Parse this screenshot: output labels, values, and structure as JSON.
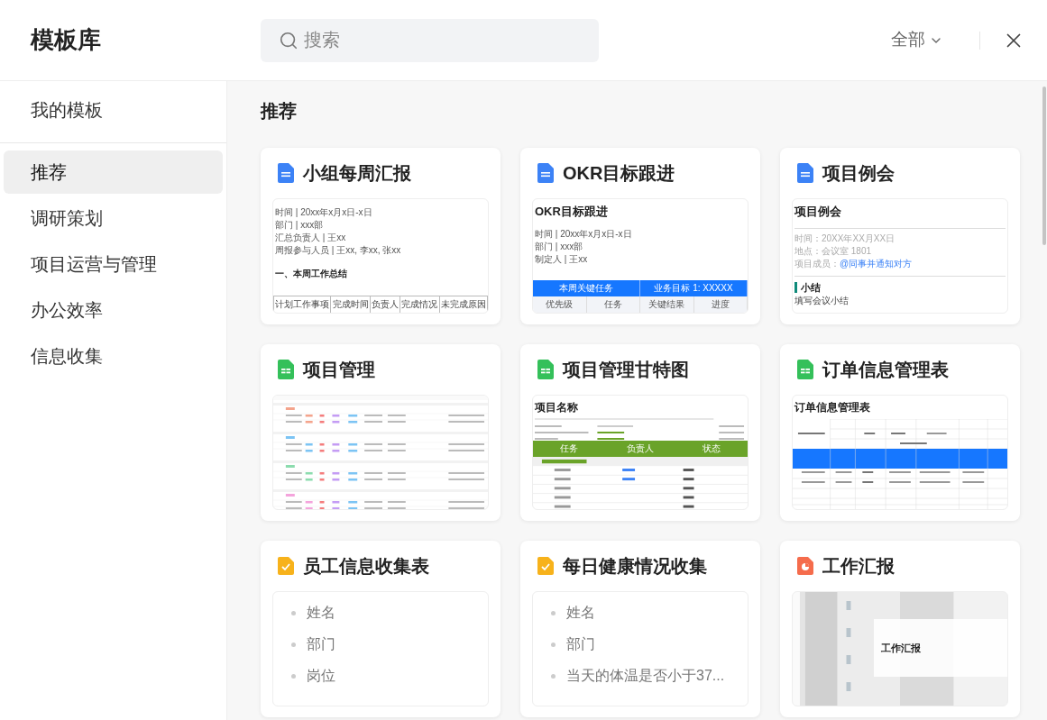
{
  "header": {
    "title": "模板库",
    "search": {
      "placeholder": "搜索"
    },
    "filter": "全部"
  },
  "sidebar": {
    "my_templates": {
      "label": "我的模板",
      "selected": false
    },
    "categories": [
      {
        "label": "推荐",
        "selected": true
      },
      {
        "label": "调研策划",
        "selected": false
      },
      {
        "label": "项目运营与管理",
        "selected": false
      },
      {
        "label": "办公效率",
        "selected": false
      },
      {
        "label": "信息收集",
        "selected": false
      }
    ]
  },
  "section": {
    "title": "推荐"
  },
  "templates": [
    {
      "title": "小组每周汇报",
      "kind": "doc",
      "preview": {
        "kind": "doc",
        "lines": [
          "时间 | 20xx年x月x日-x日",
          "部门 | xxx部",
          "汇总负责人 | 王xx",
          "周报参与人员 | 王xx, 李xx, 张xx"
        ],
        "heading": "一、本周工作总结",
        "table_headers": [
          "计划工作事项",
          "完成时间",
          "负责人",
          "完成情况",
          "未完成原因"
        ]
      }
    },
    {
      "title": "OKR目标跟进",
      "kind": "doc",
      "preview": {
        "kind": "okr",
        "title": "OKR目标跟进",
        "lines": [
          "时间 | 20xx年x月x日-x日",
          "部门 | xxx部",
          "制定人 | 王xx"
        ],
        "band": [
          "本周关键任务",
          "业务目标 1: XXXXX"
        ],
        "columns": [
          "优先级",
          "任务",
          "关键结果",
          "进度"
        ]
      }
    },
    {
      "title": "项目例会",
      "kind": "doc",
      "preview": {
        "kind": "meeting",
        "title": "项目例会",
        "lines": [
          "时间：20XX年XX月XX日",
          "地点：会议室 1801"
        ],
        "member_label": "项目成员：",
        "member_link": "@同事并通知对方",
        "section": "小结",
        "note": "填写会议小结"
      }
    },
    {
      "title": "项目管理",
      "kind": "sheet",
      "preview": {
        "kind": "sheet"
      }
    },
    {
      "title": "项目管理甘特图",
      "kind": "sheet",
      "preview": {
        "kind": "gantt",
        "title": "项目名称",
        "columns": [
          "任务",
          "负责人",
          "状态"
        ]
      }
    },
    {
      "title": "订单信息管理表",
      "kind": "sheet",
      "preview": {
        "kind": "order",
        "title": "订单信息管理表"
      }
    },
    {
      "title": "员工信息收集表",
      "kind": "form",
      "preview": {
        "kind": "list",
        "items": [
          "姓名",
          "部门",
          "岗位"
        ]
      }
    },
    {
      "title": "每日健康情况收集",
      "kind": "form",
      "preview": {
        "kind": "list",
        "items": [
          "姓名",
          "部门",
          "当天的体温是否小于37..."
        ]
      }
    },
    {
      "title": "工作汇报",
      "kind": "slides",
      "preview": {
        "kind": "slide",
        "title": "工作汇报"
      }
    }
  ]
}
